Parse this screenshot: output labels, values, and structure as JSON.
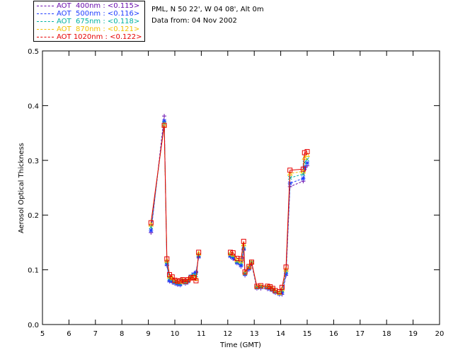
{
  "info": {
    "site": "PML, N 50 22', W 04 08', Alt 0m",
    "date": "Data from: 04 Nov 2002"
  },
  "legend": [
    {
      "label": "AOT  400nm : <0.115>",
      "color": "#6a0dad"
    },
    {
      "label": "AOT  500nm : <0.116>",
      "color": "#1e3cff"
    },
    {
      "label": "AOT  675nm : <0.118>",
      "color": "#00b2a0"
    },
    {
      "label": "AOT  870nm : <0.121>",
      "color": "#f2c200"
    },
    {
      "label": "AOT 1020nm : <0.122>",
      "color": "#e60000"
    }
  ],
  "chart_data": {
    "type": "line",
    "xlabel": "Time (GMT)",
    "ylabel": "Aerosol Optical Thickness",
    "xlim": [
      5,
      20
    ],
    "ylim": [
      0,
      0.5
    ],
    "xticks": [
      "5",
      "6",
      "7",
      "8",
      "9",
      "10",
      "11",
      "12",
      "13",
      "14",
      "15",
      "16",
      "17",
      "18",
      "19",
      "20"
    ],
    "yticks": [
      "0.0",
      "0.1",
      "0.2",
      "0.3",
      "0.4",
      "0.5"
    ],
    "grid": false,
    "legend_position": "top-left, outside plot",
    "series": [
      {
        "name": "AOT  400nm",
        "color": "#6a0dad",
        "marker": "plus",
        "x": [
          9.1,
          9.6,
          9.7,
          9.8,
          9.9,
          10.0,
          10.1,
          10.2,
          10.3,
          10.4,
          10.5,
          10.6,
          10.7,
          10.8,
          10.9,
          12.1,
          12.2,
          12.35,
          12.5,
          12.6,
          12.65,
          12.8,
          12.9,
          13.1,
          13.25,
          13.5,
          13.6,
          13.7,
          13.8,
          13.95,
          14.05,
          14.2,
          14.35,
          14.85,
          14.9,
          15.0
        ],
        "y": [
          0.168,
          0.381,
          0.108,
          0.079,
          0.077,
          0.075,
          0.073,
          0.072,
          0.078,
          0.075,
          0.077,
          0.086,
          0.09,
          0.096,
          0.123,
          0.124,
          0.12,
          0.112,
          0.106,
          0.137,
          0.09,
          0.1,
          0.111,
          0.066,
          0.066,
          0.065,
          0.064,
          0.061,
          0.058,
          0.055,
          0.055,
          0.09,
          0.252,
          0.262,
          0.283,
          0.29
        ]
      },
      {
        "name": "AOT  500nm",
        "color": "#1e3cff",
        "marker": "star",
        "x": [
          9.1,
          9.6,
          9.7,
          9.8,
          9.9,
          10.0,
          10.1,
          10.2,
          10.3,
          10.4,
          10.5,
          10.6,
          10.7,
          10.8,
          10.9,
          12.1,
          12.2,
          12.35,
          12.5,
          12.6,
          12.65,
          12.8,
          12.9,
          13.1,
          13.25,
          13.5,
          13.6,
          13.7,
          13.8,
          13.95,
          14.05,
          14.2,
          14.35,
          14.85,
          14.9,
          15.0
        ],
        "y": [
          0.172,
          0.372,
          0.11,
          0.08,
          0.079,
          0.076,
          0.074,
          0.073,
          0.079,
          0.076,
          0.079,
          0.088,
          0.092,
          0.095,
          0.124,
          0.125,
          0.122,
          0.113,
          0.108,
          0.138,
          0.092,
          0.102,
          0.113,
          0.067,
          0.068,
          0.067,
          0.065,
          0.063,
          0.059,
          0.056,
          0.058,
          0.093,
          0.258,
          0.267,
          0.287,
          0.295
        ]
      },
      {
        "name": "AOT  675nm",
        "color": "#00b2a0",
        "marker": "x",
        "x": [
          9.1,
          9.6,
          9.7,
          9.8,
          9.9,
          10.0,
          10.1,
          10.2,
          10.3,
          10.4,
          10.5,
          10.6,
          10.7,
          10.8,
          10.9,
          12.1,
          12.2,
          12.35,
          12.5,
          12.6,
          12.65,
          12.8,
          12.9,
          13.1,
          13.25,
          13.5,
          13.6,
          13.7,
          13.8,
          13.95,
          14.05,
          14.2,
          14.35,
          14.85,
          14.9,
          15.0
        ],
        "y": [
          0.178,
          0.368,
          0.114,
          0.084,
          0.082,
          0.078,
          0.076,
          0.075,
          0.08,
          0.077,
          0.08,
          0.087,
          0.09,
          0.09,
          0.127,
          0.128,
          0.125,
          0.115,
          0.112,
          0.142,
          0.093,
          0.104,
          0.113,
          0.068,
          0.069,
          0.068,
          0.067,
          0.064,
          0.06,
          0.057,
          0.062,
          0.097,
          0.268,
          0.275,
          0.296,
          0.302
        ]
      },
      {
        "name": "AOT  870nm",
        "color": "#f2c200",
        "marker": "triangle",
        "x": [
          9.1,
          9.6,
          9.7,
          9.8,
          9.9,
          10.0,
          10.1,
          10.2,
          10.3,
          10.4,
          10.5,
          10.6,
          10.7,
          10.8,
          10.9,
          12.1,
          12.2,
          12.35,
          12.5,
          12.6,
          12.65,
          12.8,
          12.9,
          13.1,
          13.25,
          13.5,
          13.6,
          13.7,
          13.8,
          13.95,
          14.05,
          14.2,
          14.35,
          14.85,
          14.9,
          15.0
        ],
        "y": [
          0.183,
          0.365,
          0.117,
          0.088,
          0.085,
          0.08,
          0.078,
          0.078,
          0.081,
          0.078,
          0.081,
          0.086,
          0.088,
          0.084,
          0.13,
          0.13,
          0.128,
          0.118,
          0.116,
          0.147,
          0.095,
          0.105,
          0.114,
          0.069,
          0.07,
          0.069,
          0.068,
          0.065,
          0.061,
          0.058,
          0.065,
          0.101,
          0.276,
          0.28,
          0.305,
          0.31
        ]
      },
      {
        "name": "AOT 1020nm",
        "color": "#e60000",
        "marker": "square",
        "x": [
          9.1,
          9.6,
          9.7,
          9.8,
          9.9,
          10.0,
          10.1,
          10.2,
          10.3,
          10.4,
          10.5,
          10.6,
          10.7,
          10.8,
          10.9,
          12.1,
          12.2,
          12.35,
          12.5,
          12.6,
          12.65,
          12.8,
          12.9,
          13.1,
          13.25,
          13.5,
          13.6,
          13.7,
          13.8,
          13.95,
          14.05,
          14.2,
          14.35,
          14.85,
          14.9,
          15.0
        ],
        "y": [
          0.186,
          0.364,
          0.12,
          0.091,
          0.087,
          0.081,
          0.079,
          0.08,
          0.082,
          0.079,
          0.082,
          0.085,
          0.086,
          0.08,
          0.132,
          0.132,
          0.131,
          0.121,
          0.12,
          0.152,
          0.096,
          0.106,
          0.114,
          0.07,
          0.071,
          0.07,
          0.069,
          0.066,
          0.062,
          0.06,
          0.068,
          0.105,
          0.282,
          0.284,
          0.314,
          0.316
        ]
      }
    ]
  }
}
